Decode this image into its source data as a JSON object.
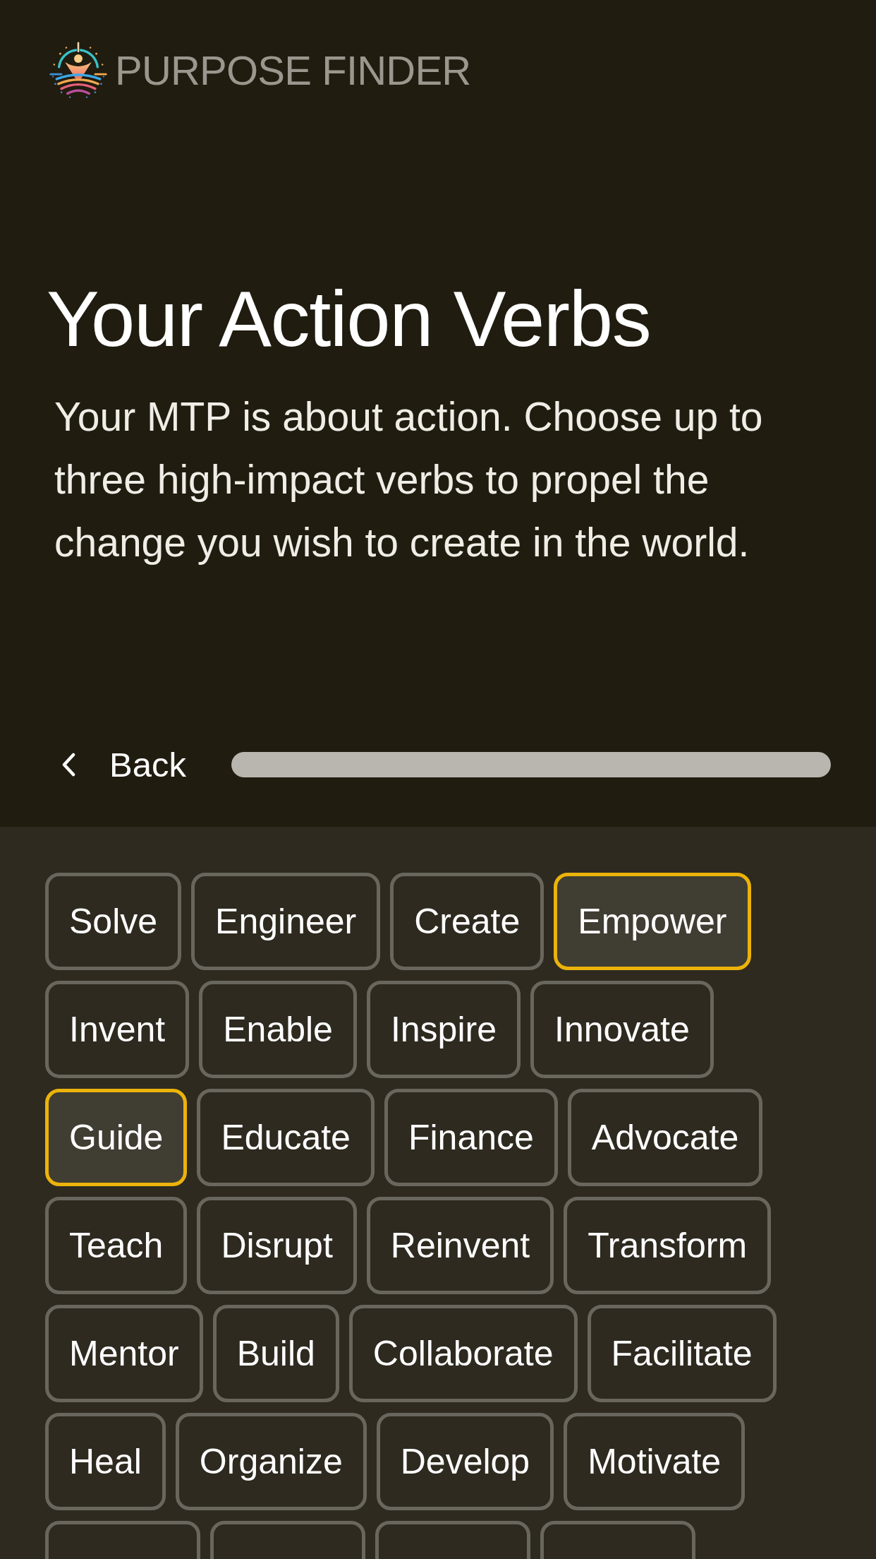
{
  "header": {
    "brand": "PURPOSE FINDER"
  },
  "intro": {
    "title": "Your Action Verbs",
    "description": "Your MTP is about action. Choose up to three high-impact verbs to propel the change you wish to create in the world."
  },
  "navigation": {
    "back_label": "Back",
    "progress": {
      "level": 1
    }
  },
  "verbs": [
    {
      "label": "Solve",
      "selected": false
    },
    {
      "label": "Engineer",
      "selected": false
    },
    {
      "label": "Create",
      "selected": false
    },
    {
      "label": "Empower",
      "selected": true
    },
    {
      "label": "Invent",
      "selected": false
    },
    {
      "label": "Enable",
      "selected": false
    },
    {
      "label": "Inspire",
      "selected": false
    },
    {
      "label": "Innovate",
      "selected": false
    },
    {
      "label": "Guide",
      "selected": true
    },
    {
      "label": "Educate",
      "selected": false
    },
    {
      "label": "Finance",
      "selected": false
    },
    {
      "label": "Advocate",
      "selected": false
    },
    {
      "label": "Teach",
      "selected": false
    },
    {
      "label": "Disrupt",
      "selected": false
    },
    {
      "label": "Reinvent",
      "selected": false
    },
    {
      "label": "Transform",
      "selected": false
    },
    {
      "label": "Mentor",
      "selected": false
    },
    {
      "label": "Build",
      "selected": false
    },
    {
      "label": "Collaborate",
      "selected": false
    },
    {
      "label": "Facilitate",
      "selected": false
    },
    {
      "label": "Heal",
      "selected": false
    },
    {
      "label": "Organize",
      "selected": false
    },
    {
      "label": "Develop",
      "selected": false
    },
    {
      "label": "Motivate",
      "selected": false
    },
    {
      "selected": false
    },
    {
      "selected": false
    },
    {
      "selected": false
    },
    {
      "selected": false
    }
  ]
}
